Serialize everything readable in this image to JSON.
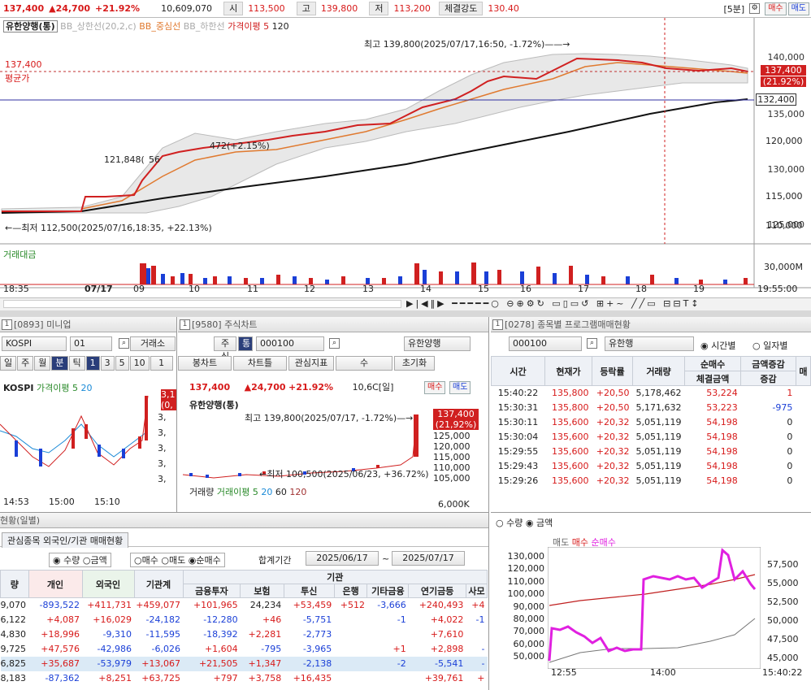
{
  "top": {
    "name": "137,400",
    "change": "▲24,700",
    "pct": "+21.92%",
    "volume": "10,609,070",
    "open_label": "시",
    "open": "113,500",
    "high_label": "고",
    "high": "139,800",
    "low_label": "저",
    "low": "113,200",
    "strength_label": "체결강도",
    "strength": "130.40",
    "period": "[5분]",
    "buy": "매수",
    "sell": "매도"
  },
  "main": {
    "title": "유한양행(통)",
    "legend": [
      "BB_상한선(20,2,c)",
      "BB_중심선",
      "BB_하한선",
      "가격이평 5",
      "120"
    ],
    "high_note": "최고 139,800(2025/07/17,16:50, -1.72%)——→",
    "low_note": "←—최저 112,500(2025/07/16,18:35, +22.13%)",
    "price_left": "137,400",
    "avg_label": "평균가",
    "ann1": "121,848(",
    "ann2": "472(+2.15%)",
    "ann3": "56",
    "yaxis": [
      "140,000",
      "135,000",
      "130,000",
      "125,000",
      "120,000",
      "115,000",
      "110,000"
    ],
    "last_price": "137,400",
    "last_pct": "(21.92%)",
    "ma_price": "132,400",
    "vol_title": "거래대금",
    "vol_axis": "30,000M",
    "xaxis": [
      "18:35",
      "07/17",
      "09",
      "10",
      "11",
      "12",
      "13",
      "14",
      "15",
      "16",
      "17",
      "18",
      "19",
      "19:55:00"
    ]
  },
  "mini": {
    "code": "[0893] 미니업",
    "sym": "KOSPI",
    "field": "01",
    "market": "거래소",
    "tabs": [
      "일",
      "주",
      "월",
      "분",
      "틱",
      "1",
      "3",
      "5",
      "10",
      "1"
    ],
    "title": "KOSPI",
    "legend": "가격이평 5",
    "legend2": "20",
    "times": [
      "14:53",
      "15:00",
      "15:10"
    ],
    "yvals": [
      "3,",
      "3,",
      "3,",
      "3,",
      "3,"
    ],
    "last": "3,1",
    "last2": "(0,"
  },
  "stock": {
    "code": "[9580] 주식차트",
    "field": "000100",
    "sym": "유한양행",
    "tabs": [
      "봉차트",
      "차트틀",
      "관심지표",
      "수",
      "초기화"
    ],
    "price": "137,400",
    "change": "▲24,700",
    "pct": "+21.92%",
    "period": "10,6C[일]",
    "buy": "매수",
    "sell": "매도",
    "title": "유한양행(통)",
    "high_note": "최고 139,800(2025/07/17, -1.72%)—→",
    "low_note": "←최저 100,500(2025/06/23, +36.72%)",
    "yaxis": [
      "125,000",
      "120,000",
      "115,000",
      "110,000",
      "105,000"
    ],
    "last": "137,400",
    "lastpct": "(21,92%)",
    "vol_label": "거래량",
    "vol_legend": "거래이평 5",
    "v20": "20",
    "v60": "60",
    "v120": "120",
    "vol_axis": "6,000K"
  },
  "program": {
    "code": "[0278] 종목별 프로그램매매현황",
    "field": "000100",
    "sym": "유한행",
    "radio1": "시간별",
    "radio2": "일자별",
    "headers": [
      "시간",
      "현재가",
      "등락률",
      "거래량",
      "순매수",
      "체결금액",
      "증감",
      "매"
    ],
    "combo": "금액증감",
    "rows": [
      [
        "15:40:22",
        "135,800",
        "+20,50",
        "5,178,462",
        "53,224",
        "1"
      ],
      [
        "15:30:31",
        "135,800",
        "+20,50",
        "5,171,632",
        "53,223",
        "-975"
      ],
      [
        "15:30:11",
        "135,600",
        "+20,32",
        "5,051,119",
        "54,198",
        "0"
      ],
      [
        "15:30:04",
        "135,600",
        "+20,32",
        "5,051,119",
        "54,198",
        "0"
      ],
      [
        "15:29:55",
        "135,600",
        "+20,32",
        "5,051,119",
        "54,198",
        "0"
      ],
      [
        "15:29:43",
        "135,600",
        "+20,32",
        "5,051,119",
        "54,198",
        "0"
      ],
      [
        "15:29:26",
        "135,600",
        "+20,32",
        "5,051,119",
        "54,198",
        "0"
      ]
    ],
    "r_qty": "수량",
    "r_amt": "금액",
    "leg": [
      "매도",
      "매수",
      "순매수"
    ],
    "yl": [
      "130,000",
      "120,000",
      "110,000",
      "100,000",
      "90,000",
      "80,000",
      "70,000",
      "60,000",
      "50,000"
    ],
    "yr": [
      "57,500",
      "55,000",
      "52,500",
      "50,000",
      "47,500",
      "45,000"
    ],
    "xt": [
      "12:55",
      "14:00",
      "15:40:22"
    ]
  },
  "inv": {
    "title": "현황(일별)",
    "tab": "관심종목 외국인/기관 매매현황",
    "rq": "수량",
    "ra": "금액",
    "rb": "매수",
    "rs": "매도",
    "rn": "순매수",
    "period_label": "합계기간",
    "from": "2025/06/17",
    "to": "2025/07/17",
    "h1": [
      "량",
      "개인",
      "외국인",
      "기관계"
    ],
    "inst": "기관",
    "h2": [
      "금융투자",
      "보험",
      "투신",
      "은행",
      "기타금융",
      "연기금등",
      "사모"
    ],
    "rows": [
      [
        "9,070",
        "-893,522",
        "+411,731",
        "+459,077",
        "+101,965",
        "24,234",
        "+53,459",
        "+512",
        "-3,666",
        "+240,493",
        "+4"
      ],
      [
        "6,122",
        "+4,087",
        "+16,029",
        "-24,182",
        "-12,280",
        "+46",
        "-5,751",
        "",
        "-1",
        "+4,022",
        "-1"
      ],
      [
        "4,830",
        "+18,996",
        "-9,310",
        "-11,595",
        "-18,392",
        "+2,281",
        "-2,773",
        "",
        "",
        "+7,610",
        ""
      ],
      [
        "9,725",
        "+47,576",
        "-42,986",
        "-6,026",
        "+1,604",
        "-795",
        "-3,965",
        "",
        "+1",
        "+2,898",
        "-"
      ],
      [
        "6,825",
        "+35,687",
        "-53,979",
        "+13,067",
        "+21,505",
        "+1,347",
        "-2,138",
        "",
        "-2",
        "-5,541",
        "-"
      ],
      [
        "8,183",
        "-87,362",
        "+8,251",
        "+63,725",
        "+797",
        "+3,758",
        "+16,435",
        "",
        "",
        "+39,761",
        "+"
      ]
    ]
  }
}
